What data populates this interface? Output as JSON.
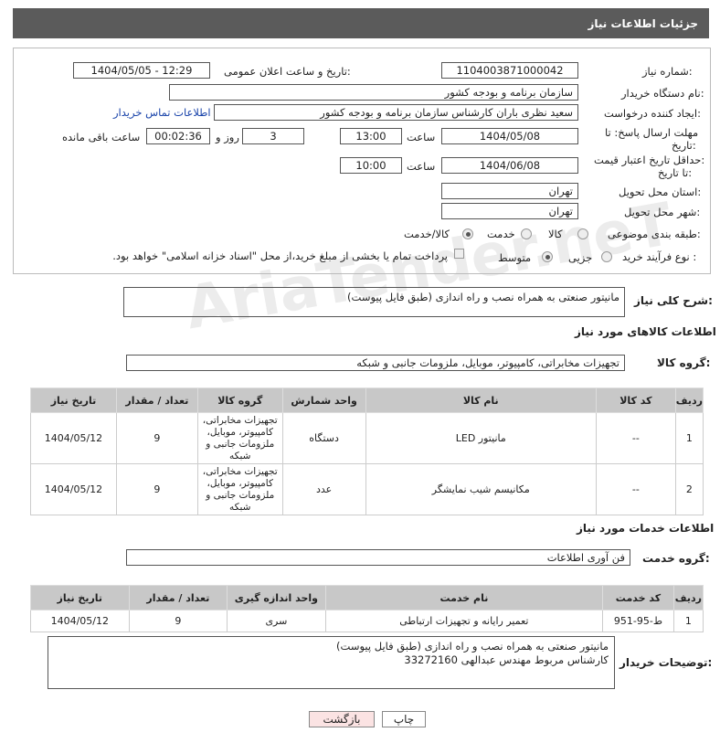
{
  "header": {
    "title": "جزئیات اطلاعات نیاز"
  },
  "fields": {
    "need_number_label": "شماره نیاز:",
    "need_number": "1104003871000042",
    "announce_label": "تاریخ و ساعت اعلان عمومی:",
    "announce_value": "1404/05/05 - 12:29",
    "buyer_org_label": "نام دستگاه خریدار:",
    "buyer_org": "سازمان برنامه و بودجه کشور",
    "creator_label": "ایجاد کننده درخواست:",
    "creator": "سعید نظری باران کارشناس سازمان برنامه و بودجه کشور",
    "contact_link": "اطلاعات تماس خریدار",
    "deadline_label_1": "مهلت ارسال پاسخ: تا",
    "deadline_label_2": "تاریخ:",
    "deadline_date": "1404/05/08",
    "time_label": "ساعت",
    "deadline_time": "13:00",
    "days_value": "3",
    "days_label": "روز و",
    "remaining_time": "00:02:36",
    "remaining_label": "ساعت باقی مانده",
    "validity_label_1": "حداقل تاریخ اعتبار قیمت:",
    "validity_label_2": "تا تاریخ:",
    "validity_date": "1404/06/08",
    "validity_time": "10:00",
    "province_label": "استان محل تحویل:",
    "province": "تهران",
    "city_label": "شهر محل تحویل:",
    "city": "تهران",
    "category_label": "طبقه بندی موضوعی:",
    "category_options": [
      "کالا",
      "خدمت",
      "کالا/خدمت"
    ],
    "process_label": "نوع فرآیند خرید :",
    "process_options": [
      "جزیی",
      "متوسط"
    ],
    "payment_note": "پرداخت تمام یا بخشی از مبلغ خرید،از محل \"اسناد خزانه اسلامی\" خواهد بود."
  },
  "summary": {
    "label": "شرح کلی نیاز:",
    "value": "مانیتور صنعتی به همراه نصب و راه اندازی (طبق فایل پیوست)"
  },
  "goods": {
    "section_title": "اطلاعات کالاهای مورد نیاز",
    "group_label": "گروه کالا:",
    "group_value": "تجهیزات مخابراتی، کامپیوتر، موبایل، ملزومات جانبی و شبکه",
    "columns": [
      "ردیف",
      "کد کالا",
      "نام کالا",
      "واحد شمارش",
      "گروه کالا",
      "تعداد / مقدار",
      "تاریخ نیاز"
    ],
    "rows": [
      {
        "idx": "1",
        "code": "--",
        "name": "مانیتور LED",
        "unit": "دستگاه",
        "group": "تجهیزات مخابراتی، کامپیوتر، موبایل، ملزومات جانبی و شبکه",
        "qty": "9",
        "date": "1404/05/12"
      },
      {
        "idx": "2",
        "code": "--",
        "name": "مکانیسم شیب نمایشگر",
        "unit": "عدد",
        "group": "تجهیزات مخابراتی، کامپیوتر، موبایل، ملزومات جانبی و شبکه",
        "qty": "9",
        "date": "1404/05/12"
      }
    ]
  },
  "services": {
    "section_title": "اطلاعات خدمات مورد نیاز",
    "group_label": "گروه خدمت:",
    "group_value": "فن آوری اطلاعات",
    "columns": [
      "ردیف",
      "کد خدمت",
      "نام خدمت",
      "واحد اندازه گیری",
      "تعداد / مقدار",
      "تاریخ نیاز"
    ],
    "rows": [
      {
        "idx": "1",
        "code": "ط-95-951",
        "name": "تعمیر رایانه و تجهیزات ارتباطی",
        "unit": "سری",
        "qty": "9",
        "date": "1404/05/12"
      }
    ]
  },
  "buyer_notes": {
    "label": "توضیحات خریدار:",
    "line1": "مانیتور صنعتی به همراه نصب و راه اندازی (طبق فایل پیوست)",
    "line2": "کارشناس مربوط مهندس عبدالهی 33272160"
  },
  "buttons": {
    "print": "چاپ",
    "back": "بازگشت"
  },
  "watermark": "AriaTender.neT",
  "colors": {
    "header_bg": "#5b5b5b",
    "table_header_bg": "#c8c8c8",
    "link": "#1a44aa",
    "back_btn_bg": "#fbe3e3"
  }
}
